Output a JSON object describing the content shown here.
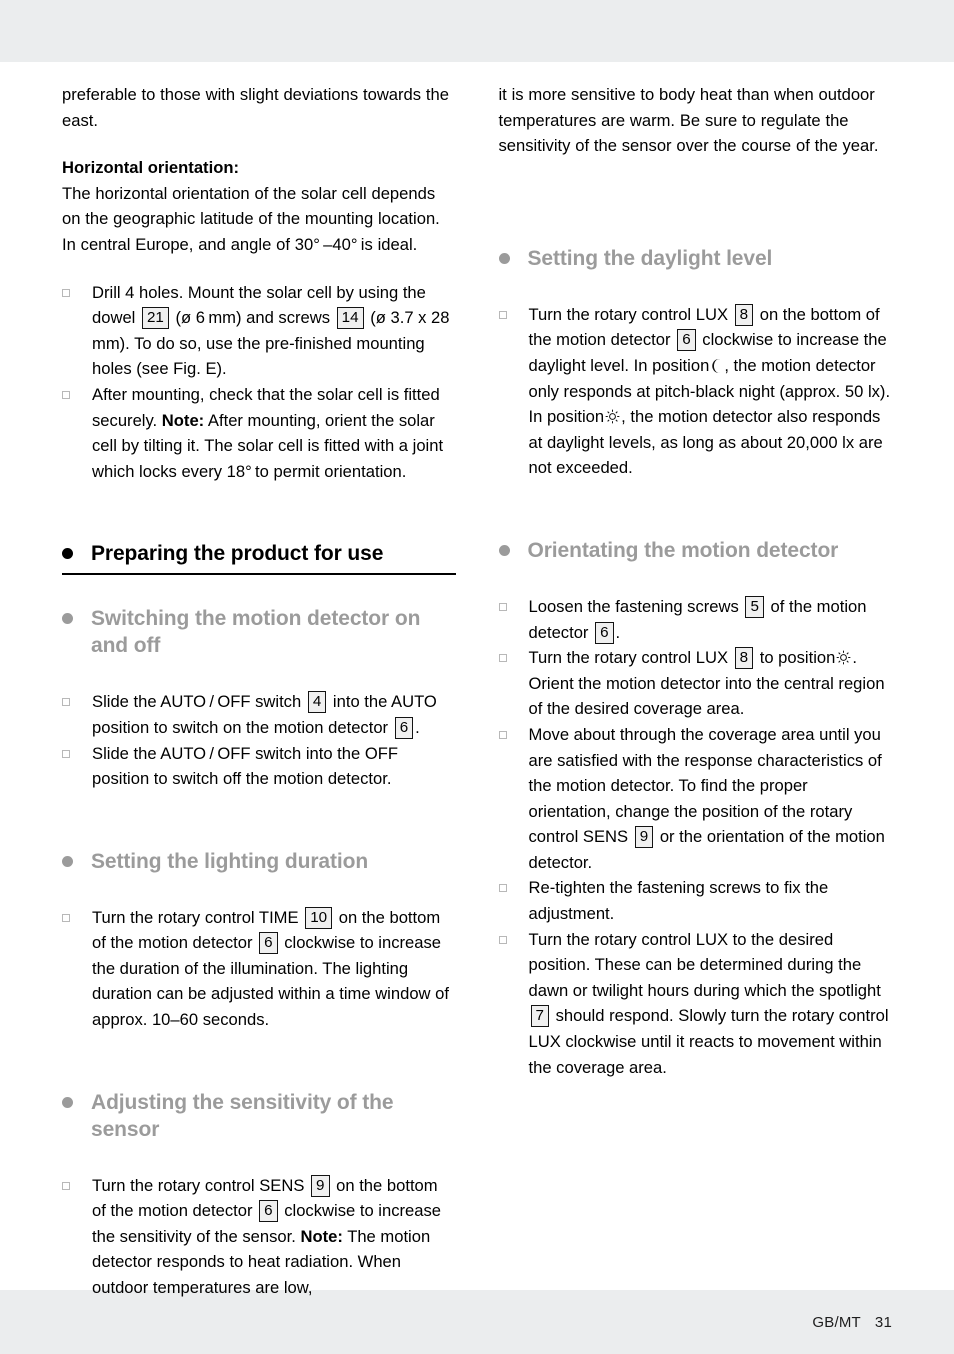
{
  "page": {
    "footer_lang": "GB/MT",
    "footer_page_number": "31",
    "band_color": "#ebedee",
    "heading_gray": "#9b9b9b",
    "text_color": "#000000"
  },
  "left_column": {
    "continued_paragraph": "preferable to those with slight deviations towards the east.",
    "horizontal_orientation": {
      "subhead": "Horizontal orientation:",
      "body": "The horizontal orientation of the solar cell depends on the geographic latitude of the mounting location. In central Europe, and angle of 30° –40° is ideal."
    },
    "mounting_steps": [
      {
        "text_1": "Drill 4 holes. Mount the solar cell by using the dowel",
        "ref_1": "21",
        "text_2": "(ø 6 mm) and screws",
        "ref_2": "14",
        "text_3": "(ø 3.7 x 28 mm). To do so, use the pre-finished mounting holes (see Fig. E)."
      },
      {
        "text_1": "After mounting, check that the solar cell is fitted securely.",
        "note_label": "Note:",
        "note_text": "After mounting, orient the solar cell by tilting it. The solar cell is fitted with a joint which locks every 18° to permit orientation."
      }
    ],
    "heading_preparing": "Preparing the product for use",
    "heading_switching": "Switching the motion detector on and off",
    "switching_steps": [
      {
        "text_1": "Slide the AUTO / OFF switch",
        "ref_1": "4",
        "text_2": "into the AUTO position to switch on the motion detector",
        "ref_2": "6",
        "text_3": "."
      },
      {
        "text_1": "Slide the AUTO / OFF switch into the OFF position to switch off the motion detector."
      }
    ],
    "heading_lighting_duration": "Setting the lighting duration",
    "lighting_steps": [
      {
        "text_1": "Turn the rotary control TIME",
        "ref_1": "10",
        "text_2": "on the bottom of the motion detector",
        "ref_2": "6",
        "text_3": "clockwise to increase the duration of the illumination. The lighting duration can be adjusted within a time window of approx. 10–60 seconds."
      }
    ],
    "heading_sensitivity": "Adjusting the sensitivity of the sensor",
    "sensitivity_steps": [
      {
        "text_1": "Turn the rotary control SENS",
        "ref_1": "9",
        "text_2": "on the bottom of the motion detector",
        "ref_2": "6",
        "text_3": "clockwise to increase the sensitivity of the sensor.",
        "note_label": "Note:",
        "note_text": "The motion detector responds to heat radiation. When outdoor temperatures are low,"
      }
    ]
  },
  "right_column": {
    "continued_paragraph": "it is more sensitive to body heat than when outdoor temperatures are warm. Be sure to regulate the sensitivity of the sensor over the course of the year.",
    "heading_daylight": "Setting the daylight level",
    "daylight_steps": [
      {
        "text_1": "Turn the rotary control LUX",
        "ref_1": "8",
        "text_2": "on the bottom of the motion detector",
        "ref_2": "6",
        "text_3": "clockwise to increase the daylight level. In position",
        "icon_1": "crescent-moon-icon",
        "text_4": ", the motion detector only responds at pitch-black night (approx. 50 lx). In position",
        "icon_2": "sun-icon",
        "text_5": ", the motion detector also responds at daylight levels, as long as about 20,000 lx are not exceeded."
      }
    ],
    "heading_orientating": "Orientating the motion detector",
    "orientating_steps": [
      {
        "text_1": "Loosen the fastening screws",
        "ref_1": "5",
        "text_2": "of the motion detector",
        "ref_2": "6",
        "text_3": "."
      },
      {
        "text_1": "Turn the rotary control LUX",
        "ref_1": "8",
        "text_2": "to position",
        "icon_1": "sun-icon",
        "text_3": ". Orient the motion detector into the central region of the desired coverage area."
      },
      {
        "text_1": "Move about through the coverage area until you are satisfied with the response characteristics of the motion detector. To find the proper orientation, change the position of the rotary control SENS",
        "ref_1": "9",
        "text_2": "or the orientation of the motion detector."
      },
      {
        "text_1": "Re-tighten the fastening screws to fix the adjustment."
      },
      {
        "text_1": "Turn the rotary control LUX to the desired position. These can be determined during the dawn or twilight hours during which the spotlight",
        "ref_1": "7",
        "text_2": "should respond. Slowly turn the rotary control LUX clockwise until it reacts to movement within the coverage area."
      }
    ]
  }
}
